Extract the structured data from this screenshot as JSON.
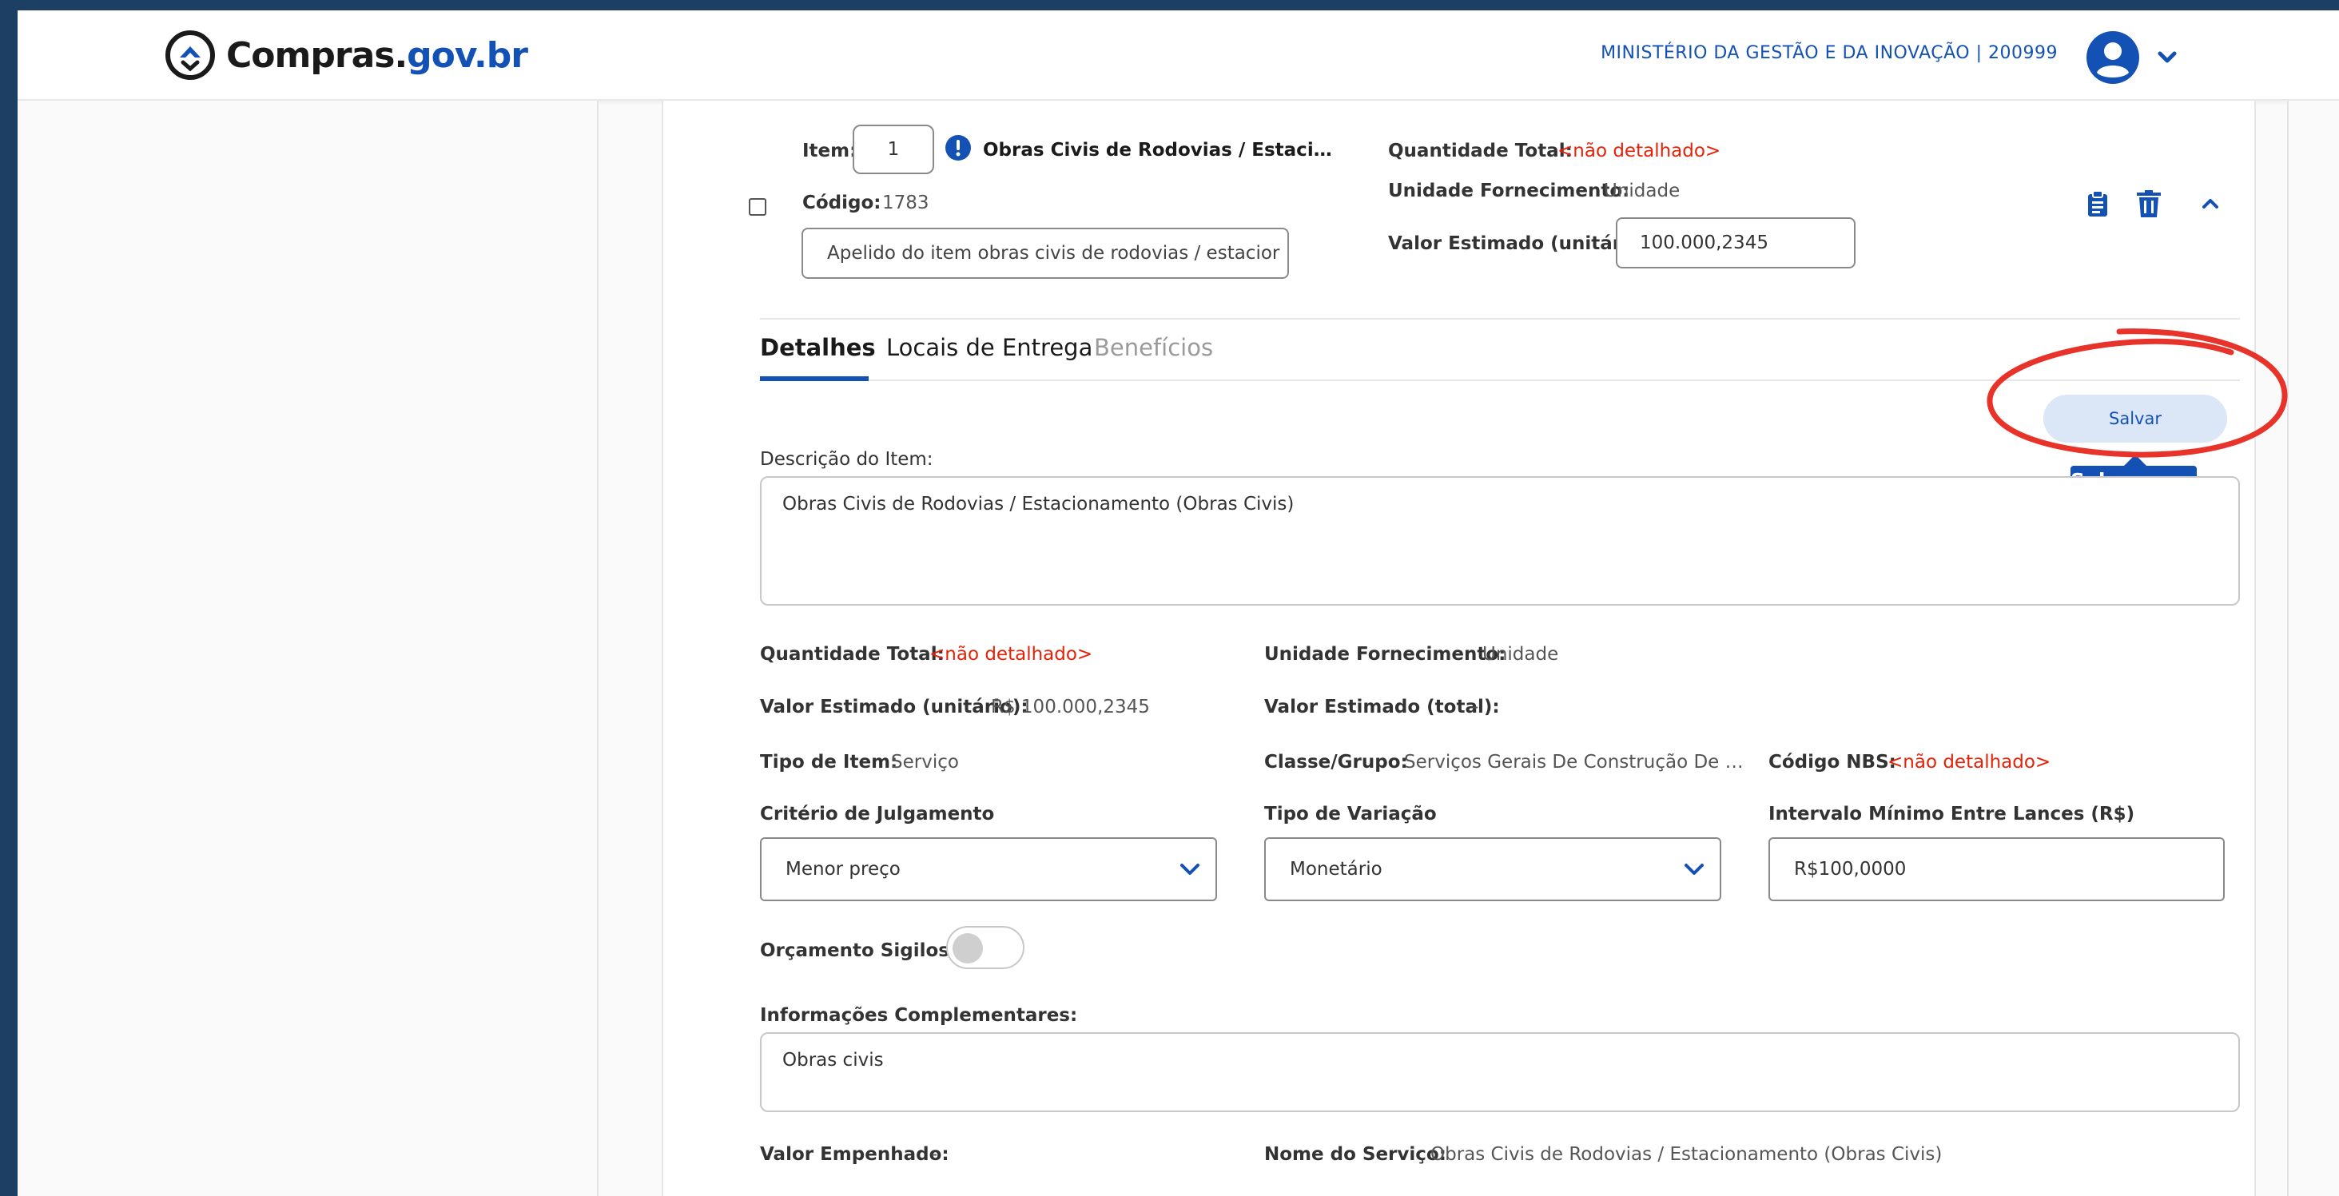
{
  "header": {
    "logo_text_main": "Compras.",
    "logo_text_suffix": "gov.br",
    "org": "MINISTÉRIO DA GESTÃO E DA INOVAÇÃO | 200999"
  },
  "item": {
    "item_label": "Item:",
    "item_number": "1",
    "item_name": "Obras Civis de Rodovias / Estaci…",
    "codigo_label": "Código:",
    "codigo_value": "1783",
    "apelido_value": "Apelido do item obras civis de rodovias / estacior",
    "quantidade_label": "Quantidade Total:",
    "quantidade_value": "<não detalhado>",
    "unidade_label": "Unidade Fornecimento:",
    "unidade_value": "Unidade",
    "valor_label": "Valor Estimado (unitário):",
    "valor_value": "100.000,2345"
  },
  "tabs": [
    {
      "label": "Detalhes"
    },
    {
      "label": "Locais de Entrega"
    },
    {
      "label": "Benefícios"
    }
  ],
  "actions": {
    "save_label": "Salvar",
    "save_tooltip": "Salvar item"
  },
  "details": {
    "descricao_label": "Descrição do Item:",
    "descricao_value": "Obras Civis de Rodovias / Estacionamento (Obras Civis)",
    "quantidade_label": "Quantidade Total:",
    "quantidade_value": "<não detalhado>",
    "unidade_label": "Unidade Fornecimento:",
    "unidade_value": "Unidade",
    "valor_unit_label": "Valor Estimado (unitário):",
    "valor_unit_value": "R$ 100.000,2345",
    "valor_total_label": "Valor Estimado (total):",
    "valor_total_value": "-",
    "tipo_label": "Tipo de Item:",
    "tipo_value": "Serviço",
    "classe_label": "Classe/Grupo:",
    "classe_value": "Serviços Gerais De Construção De …",
    "nbs_label": "Código NBS:",
    "nbs_value": "<não detalhado>",
    "criterio_label": "Critério de Julgamento",
    "criterio_value": "Menor preço",
    "variacao_label": "Tipo de Variação",
    "variacao_value": "Monetário",
    "intervalo_label": "Intervalo Mínimo Entre Lances (R$)",
    "intervalo_value": "R$100,0000",
    "sigiloso_label": "Orçamento Sigiloso:",
    "info_label": "Informações Complementares:",
    "info_value": "Obras civis",
    "empenhado_label": "Valor Empenhado:",
    "empenhado_value": "-",
    "servico_label": "Nome do Serviço:",
    "servico_value": "Obras Civis de Rodovias / Estacionamento (Obras Civis)"
  },
  "colors": {
    "primary": "#1351b4",
    "danger": "#e52207",
    "annotation": "#e8332a"
  },
  "icons": [
    "compras-logo-icon",
    "user-avatar-icon",
    "chevron-down-icon",
    "info-icon",
    "clipboard-icon",
    "trash-icon",
    "chevron-up-icon"
  ]
}
